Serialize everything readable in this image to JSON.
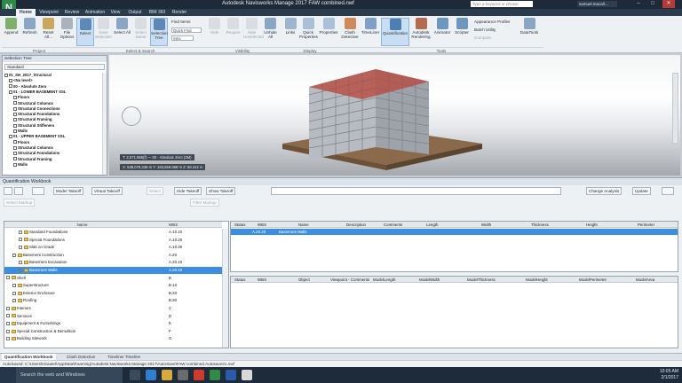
{
  "window": {
    "app_logo": "N",
    "title": "Autodesk Navisworks Manage 2017  FAW combined.nwf",
    "search_placeholder": "Type a keyword or phrase",
    "user": "samuel.macall..."
  },
  "menu": {
    "tabs": [
      "Home",
      "Viewpoint",
      "Review",
      "Animation",
      "View",
      "Output",
      "BIM 360",
      "Render"
    ],
    "active_tab": "Home"
  },
  "ribbon": {
    "buttons": [
      {
        "label": "Append",
        "name": "append-button"
      },
      {
        "label": "Refresh",
        "name": "refresh-button"
      },
      {
        "label": "Reset All...",
        "name": "reset-all-button"
      },
      {
        "label": "File Options",
        "name": "file-options-button"
      },
      {
        "label": "Select",
        "name": "select-button"
      },
      {
        "label": "Save Selection",
        "name": "save-selection-button"
      },
      {
        "label": "Select All",
        "name": "select-all-button"
      },
      {
        "label": "Select Same",
        "name": "select-same-button"
      },
      {
        "label": "Selection Tree",
        "name": "selection-tree-button"
      },
      {
        "label": "Hide",
        "name": "hide-button"
      },
      {
        "label": "Require",
        "name": "require-button"
      },
      {
        "label": "Hide Unselected",
        "name": "hide-unselected-button"
      },
      {
        "label": "Unhide All",
        "name": "unhide-all-button"
      },
      {
        "label": "Links",
        "name": "links-button"
      },
      {
        "label": "Quick Properties",
        "name": "quick-properties-button"
      },
      {
        "label": "Properties",
        "name": "properties-button"
      },
      {
        "label": "Clash Detective",
        "name": "clash-detective-button"
      },
      {
        "label": "TimeLiner",
        "name": "timeliner-button"
      },
      {
        "label": "Quantification",
        "name": "quantification-button"
      },
      {
        "label": "Autodesk Rendering",
        "name": "autodesk-rendering-button"
      },
      {
        "label": "Animator",
        "name": "animator-button"
      },
      {
        "label": "Scripter",
        "name": "scripter-button"
      },
      {
        "label": "DataTools",
        "name": "datatools-button"
      }
    ],
    "find_items": "Find Items",
    "quick_find": "Quick Find",
    "sets": "Sets",
    "appearance_profiler": "Appearance Profiler",
    "batch_utility": "Batch Utility",
    "compare": "Compare",
    "groups": [
      "Project",
      "Select & Search",
      "Visibility",
      "Display",
      "Tools"
    ]
  },
  "selection_tree": {
    "title": "Selection Tree",
    "dropdown": "Standard",
    "items": [
      "01_SH_2017_Structural",
      "<No level>",
      "00 - Absolute Zero",
      "01 - LOWER BASEMENT SSL",
      "Floors",
      "Structural Columns",
      "Structural Connections",
      "Structural Foundations",
      "Structural Framing",
      "Structural Stiffeners",
      "Walls",
      "01 - UPPER BASEMENT SSL",
      "Floors",
      "Structural Columns",
      "Structural Foundations",
      "Structural Framing",
      "Walls"
    ]
  },
  "viewport": {
    "info": "T: 2,571.985(f) — 00 - Absolute Zero (3M)",
    "coords": "X: 538,079.338 m  Y: 183,559.068 m  Z: 58.242 m"
  },
  "quantification": {
    "title": "Quantification Workbook",
    "toolbar1": {
      "model_takeoff": "Model Takeoff",
      "virtual_takeoff": "Virtual Takeoff",
      "select": "Select",
      "hide_takeoff": "Hide Takeoff",
      "show_takeoff": "Show Takeoff",
      "change_analysis": "Change Analysis",
      "update": "Update"
    },
    "toolbar2": {
      "select_markup": "Select Markup",
      "filter_markup": "Filter Markup"
    },
    "catalog_headers": {
      "name": "Name",
      "wbs": "WBS"
    },
    "catalog_rows": [
      {
        "name": "Standard Foundations",
        "wbs": "A.10.10",
        "indent": 2
      },
      {
        "name": "Special Foundations",
        "wbs": "A.10.20",
        "indent": 2
      },
      {
        "name": "Slab on Grade",
        "wbs": "A.10.30",
        "indent": 2
      },
      {
        "name": "Basement Construction",
        "wbs": "A.20",
        "indent": 1
      },
      {
        "name": "Basement Excavation",
        "wbs": "A.20.10",
        "indent": 2
      },
      {
        "name": "Basement Walls",
        "wbs": "A.20.20",
        "indent": 2,
        "selected": true
      },
      {
        "name": "Shell",
        "wbs": "B",
        "indent": 0
      },
      {
        "name": "Superstructure",
        "wbs": "B.10",
        "indent": 1
      },
      {
        "name": "Exterior Enclosure",
        "wbs": "B.20",
        "indent": 1
      },
      {
        "name": "Roofing",
        "wbs": "B.30",
        "indent": 1
      },
      {
        "name": "Interiors",
        "wbs": "C",
        "indent": 0
      },
      {
        "name": "Services",
        "wbs": "D",
        "indent": 0
      },
      {
        "name": "Equipment & Furnishings",
        "wbs": "E",
        "indent": 0
      },
      {
        "name": "Special Construction & Demolition",
        "wbs": "F",
        "indent": 0
      },
      {
        "name": "Building Sitework",
        "wbs": "G",
        "indent": 0
      }
    ],
    "items_headers": [
      "Status",
      "WBS",
      "Name",
      "Description",
      "Comments",
      "Length",
      "Width",
      "Thickness",
      "Height",
      "Perimeter"
    ],
    "items_row": {
      "wbs": "A.20.20",
      "name": "Basement Walls"
    },
    "resource_headers": [
      "Status",
      "WBS",
      "Object",
      "Viewpoint - Comments",
      "ModelLength",
      "ModelWidth",
      "ModelThickness",
      "ModelHeight",
      "ModelPerimeter",
      "ModelArea"
    ]
  },
  "bottom_tabs": [
    "Quantification Workbook",
    "Clash Detective",
    "Timeliner Timeline"
  ],
  "status": "AutoSaved: C:\\Users\\Hirautel\\AppData\\Roaming\\Autodesk Navisworks Manage 2017\\AutoSave\\FAW combined.Autosave21.nwf",
  "taskbar": {
    "search": "Search the web and Windows",
    "time": "10:05 AM",
    "date": "2/1/2017"
  },
  "colors": {
    "accent": "#3c8fe0",
    "titlebar": "#1e2a38",
    "menubar": "#2b3b4e"
  }
}
